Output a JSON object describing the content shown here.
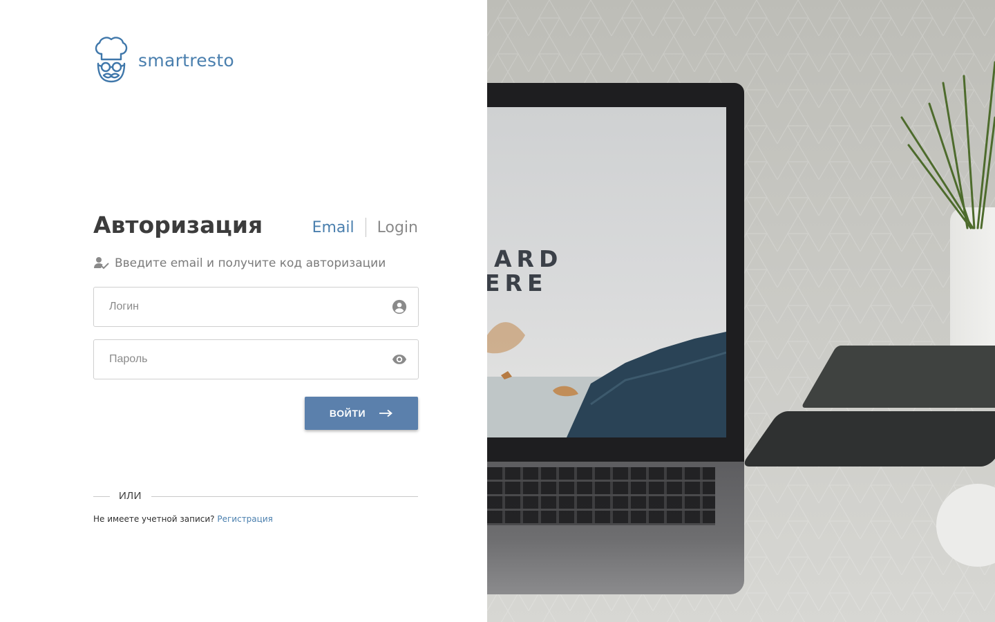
{
  "brand": {
    "name": "smartresto",
    "accent": "#4a7fae"
  },
  "auth": {
    "title": "Авторизация",
    "tabs": [
      {
        "label": "Email",
        "active": true
      },
      {
        "label": "Login",
        "active": false
      }
    ],
    "hint": "Введите email и получите код авторизации",
    "login_placeholder": "Логин",
    "password_placeholder": "Пароль",
    "submit_label": "ВОЙТИ",
    "or_label": "ИЛИ",
    "signup_text": "Не имеете учетной записи?",
    "signup_link": "Регистрация"
  },
  "photo": {
    "screen_line_1": "ARD",
    "screen_line_2": "ERE"
  },
  "icons": {
    "login_field": "account-circle-icon",
    "password_field": "eye-icon",
    "hint": "person-check-icon",
    "submit": "arrow-right-icon"
  },
  "colors": {
    "button": "#5b80ac",
    "title": "#3c3c3c",
    "muted": "#8a8a8a"
  }
}
